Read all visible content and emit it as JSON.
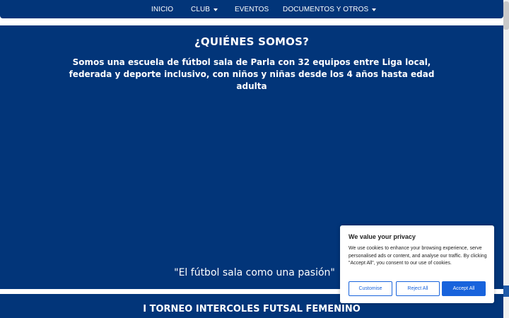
{
  "nav": {
    "items": [
      {
        "label": "INICIO",
        "dropdown": false
      },
      {
        "label": "CLUB",
        "dropdown": true
      },
      {
        "label": "EVENTOS",
        "dropdown": false
      },
      {
        "label": "DOCUMENTOS Y OTROS",
        "dropdown": true
      }
    ]
  },
  "about": {
    "title": "¿QUIÉNES SOMOS?",
    "description": "Somos una escuela de fútbol sala de Parla con 32 equipos entre Liga local, federada y deporte inclusivo, con niños y niñas desde los 4 años hasta edad adulta",
    "slogan": "\"El fútbol sala como una pasión\""
  },
  "next_section": {
    "title": "I TORNEO INTERCOLES FUTSAL FEMENINO"
  },
  "cookie_banner": {
    "title": "We value your privacy",
    "text": "We use cookies to enhance your browsing experience, serve personalised ads or content, and analyse our traffic. By clicking \"Accept All\", you consent to our use of cookies.",
    "customise_label": "Customise",
    "reject_label": "Reject All",
    "accept_label": "Accept All"
  },
  "colors": {
    "primary": "#023579",
    "button_accent": "#1863dc"
  }
}
